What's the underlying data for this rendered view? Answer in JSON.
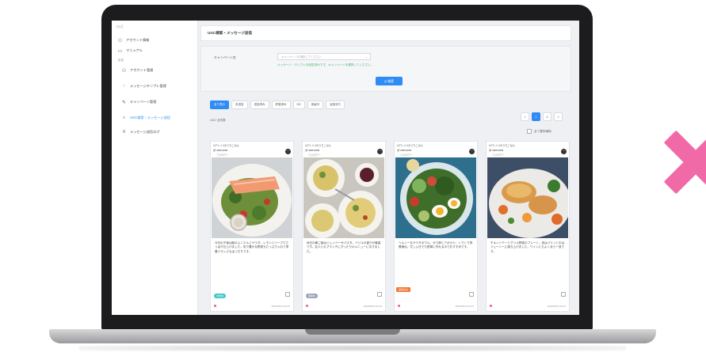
{
  "sidebar": {
    "brand": "ロゴ",
    "section_label": "設定",
    "items": [
      {
        "label": "アカウント情報",
        "icon": "user-icon"
      },
      {
        "label": "マニュアル",
        "icon": "book-icon"
      },
      {
        "label": "アカウント管理",
        "icon": "user-icon"
      },
      {
        "label": "メッセージテンプレ管理",
        "icon": "chat-icon"
      },
      {
        "label": "キャンペーン管理",
        "icon": "edit-icon"
      },
      {
        "label": "UGC検索・メッセージ送信",
        "icon": "search-icon"
      },
      {
        "label": "メッセージ送信ログ",
        "icon": "list-icon"
      }
    ]
  },
  "header": {
    "title": "UGC検索・メッセージ送信"
  },
  "filter": {
    "label": "キャンペーン名",
    "select_placeholder": "キャンペーンを選択してください",
    "note": "メッセージ・テンプレを設定済みです。キャンペーンを選択してください。",
    "search_label": "Q 検索"
  },
  "tabs": [
    "全て表示",
    "未送信",
    "送信済み",
    "許諾済み",
    "NG",
    "保留中",
    "返信待ち"
  ],
  "result_count": "UGC 全件数",
  "pager": [
    "<",
    "1",
    "2",
    ">"
  ],
  "select_all_label": "全て選択/解除",
  "colors": {
    "accent": "#2f8bf5",
    "note_green": "#45b36b",
    "x_mark": "#f06aa8"
  },
  "cards": [
    {
      "head": "#グルメ #おうちごはん",
      "user": "@ username",
      "user_sub": "フォロワー",
      "text": "今日の夕食は鮭のムニエルとサラダ。レモンとハーブでさっぱり仕上げました。彩り豊かな野菜もたっぷり入れて栄養バランスもばっちりです。",
      "badge": "未送信",
      "badge_color": "#3fc6c6",
      "flag": "",
      "date": "2020/08/12 09:12"
    },
    {
      "head": "#グルメ #おうちごはん",
      "user": "@ username",
      "user_sub": "フォロワー",
      "text": "休日の朝ご飯はジェノベーゼパスタ。バジルの香りが最高です。友人とのブランチにぴったりのメニューになりました。",
      "badge": "保留中",
      "badge_color": "#9aa3b5",
      "flag": "",
      "date": "2020/08/12 09:12"
    },
    {
      "head": "#グルメ #おうちごはん",
      "user": "@ username",
      "user_sub": "フォロワー",
      "text": "ヘルシーなサラダボウル。ゆで卵とアボカド、トマトで栄養満点。忙しい日でも簡単に作れるのでおすすめです。",
      "badge": "",
      "badge_color": "",
      "flag": "送信済み",
      "date": "2020/08/12 09:12"
    },
    {
      "head": "#グルメ #おうちごはん",
      "user": "@ username",
      "user_sub": "フォロワー",
      "text": "チキンソテーとグリル野菜のプレート。皮はパリッと中はジューシーに焼き上げました。ワインにもよく合う一皿です。",
      "badge": "",
      "badge_color": "",
      "flag": "",
      "date": "2020/08/12 09:12"
    }
  ]
}
